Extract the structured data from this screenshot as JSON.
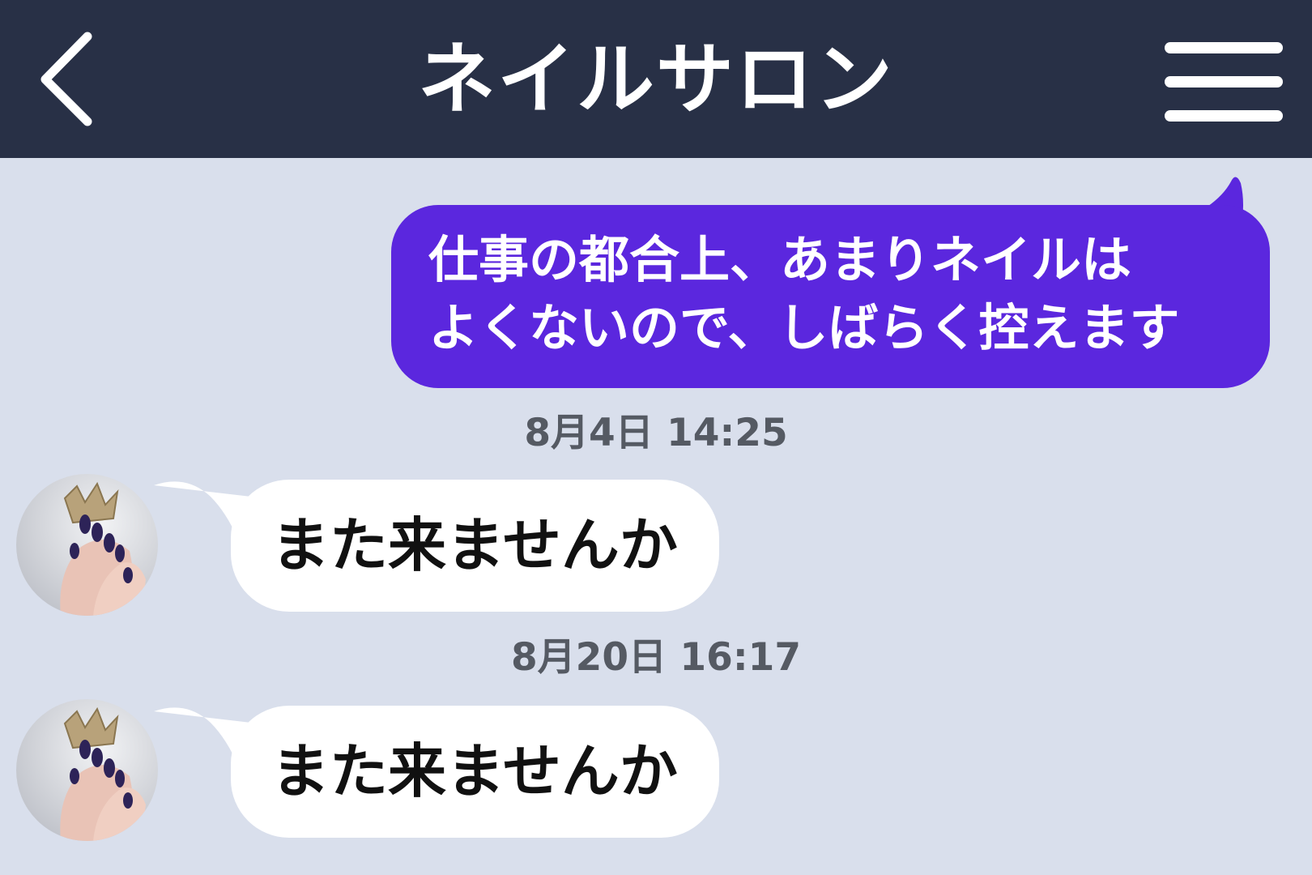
{
  "header": {
    "title": "ネイルサロン",
    "back_icon": "chevron-left-icon",
    "menu_icon": "hamburger-menu-icon"
  },
  "colors": {
    "header_bg": "#283046",
    "chat_bg": "#d9dfec",
    "outgoing_bubble": "#5b27de",
    "incoming_bubble": "#ffffff",
    "timestamp_text": "#555a63"
  },
  "messages": [
    {
      "direction": "outgoing",
      "lines": [
        "仕事の都合上、あまりネイルは",
        "よくないので、しばらく控えます"
      ]
    },
    {
      "direction": "incoming",
      "timestamp": "8月4日 14:25",
      "text": "また来ませんか"
    },
    {
      "direction": "incoming",
      "timestamp": "8月20日 16:17",
      "text": "また来ませんか"
    }
  ]
}
